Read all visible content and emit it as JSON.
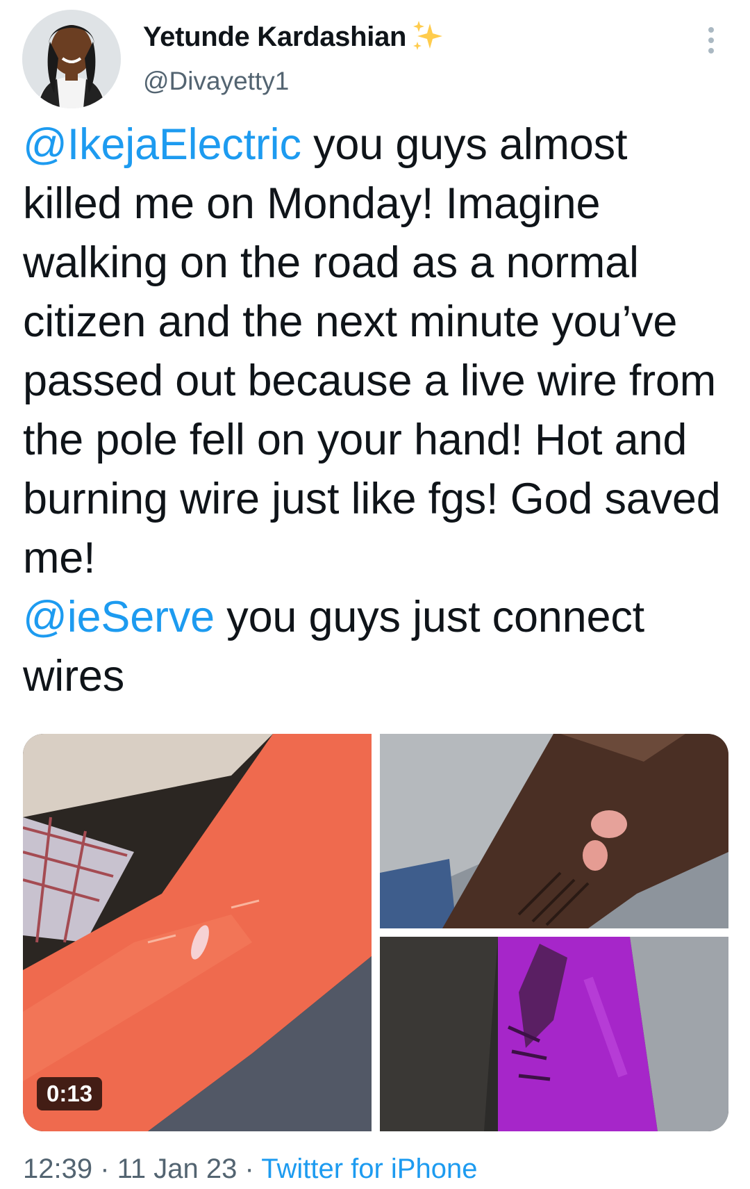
{
  "author": {
    "display_name": "Yetunde Kardashian",
    "handle": "@Divayetty1",
    "badge_icon": "sparkles-icon"
  },
  "tweet": {
    "mention_1": "@IkejaElectric",
    "text_1": " you guys almost killed me on Monday! Imagine walking on the road as a normal citizen and the next minute you’ve passed out because a live wire from the pole fell on your hand! Hot and burning wire just like fgs! God saved me!",
    "mention_2": "@ieServe",
    "text_2": " you guys just connect wires"
  },
  "media": {
    "video_duration": "0:13",
    "item_count": 3
  },
  "meta": {
    "time": "12:39",
    "separator_1": " · ",
    "date": "11 Jan 23",
    "separator_2": " · ",
    "source": "Twitter for iPhone"
  },
  "colors": {
    "link": "#1d9bf0",
    "secondary_text": "#536471",
    "primary_text": "#0f1419"
  }
}
